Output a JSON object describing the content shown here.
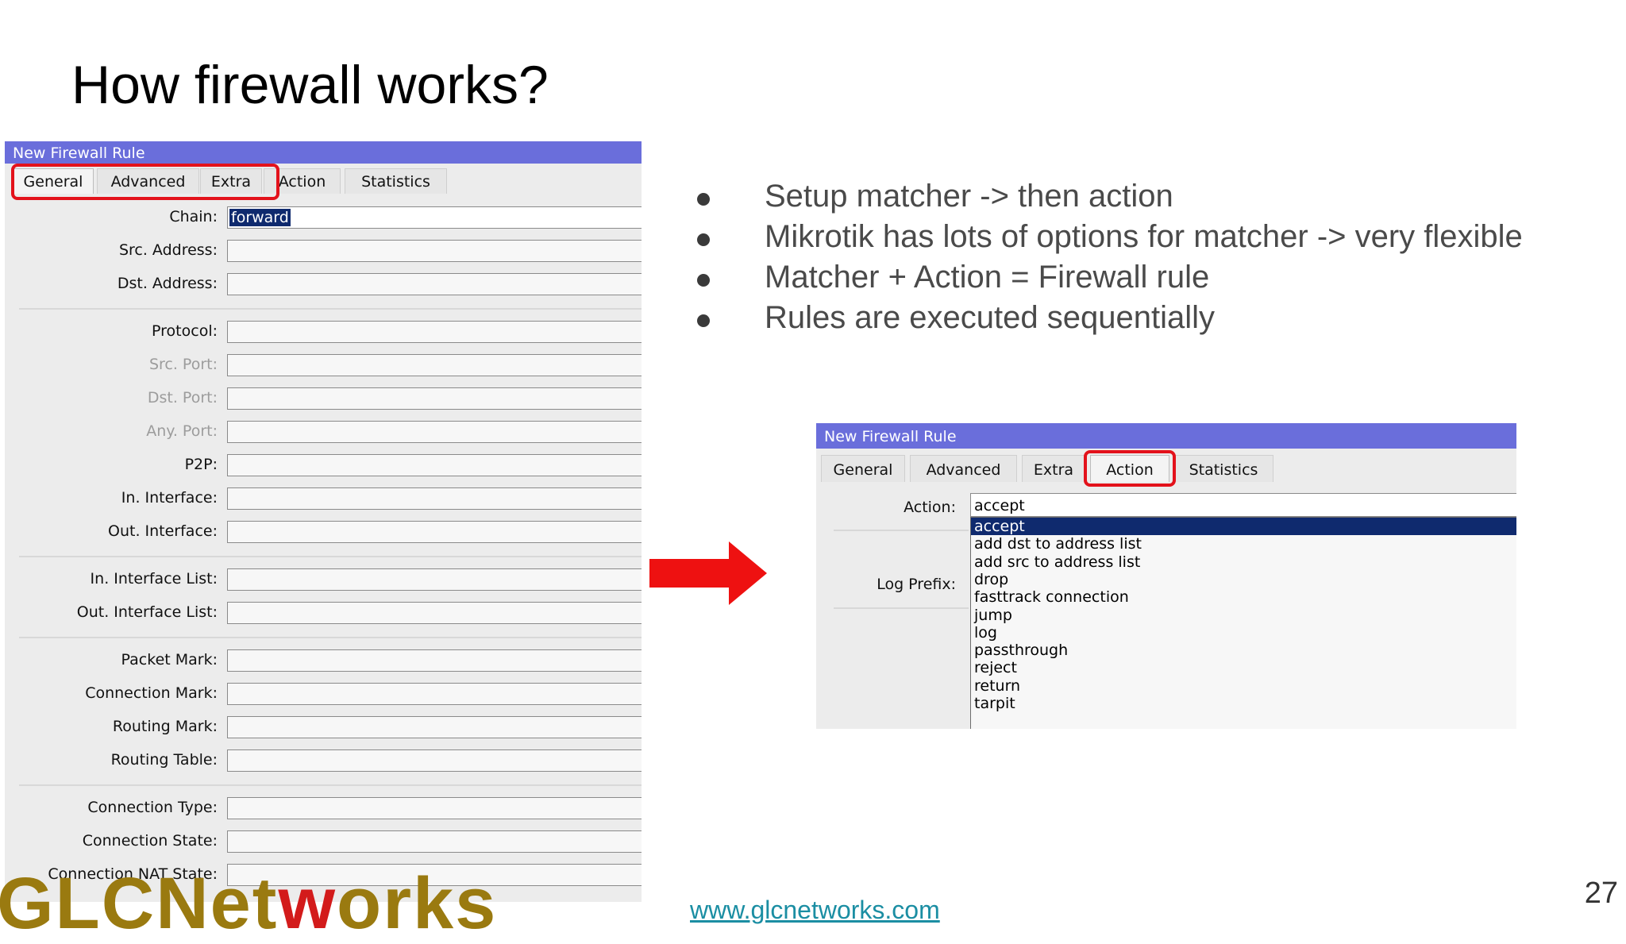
{
  "slide": {
    "title": "How firewall works?",
    "bullets": [
      "Setup matcher -> then action",
      "Mikrotik has lots of options for matcher -> very flexible",
      "Matcher + Action = Firewall rule",
      "Rules are executed sequentially"
    ],
    "footer_link": "www.glcnetworks.com",
    "page_number": "27",
    "logo_text_a": "GLC",
    "logo_text_b": "Net",
    "logo_text_c": "w",
    "logo_text_d": "orks"
  },
  "left_window": {
    "title": "New Firewall Rule",
    "tabs": [
      "General",
      "Advanced",
      "Extra",
      "Action",
      "Statistics"
    ],
    "active_tab": "General",
    "chain": {
      "label": "Chain:",
      "value": "forward"
    },
    "fields": [
      {
        "label": "Src. Address:"
      },
      {
        "label": "Dst. Address:"
      },
      {
        "label": "Protocol:"
      },
      {
        "label": "Src. Port:"
      },
      {
        "label": "Dst. Port:"
      },
      {
        "label": "Any. Port:"
      },
      {
        "label": "P2P:"
      },
      {
        "label": "In. Interface:"
      },
      {
        "label": "Out. Interface:"
      },
      {
        "label": "In. Interface List:"
      },
      {
        "label": "Out. Interface List:"
      },
      {
        "label": "Packet Mark:"
      },
      {
        "label": "Connection Mark:"
      },
      {
        "label": "Routing Mark:"
      },
      {
        "label": "Routing Table:"
      },
      {
        "label": "Connection Type:"
      },
      {
        "label": "Connection State:"
      },
      {
        "label": "Connection NAT State:"
      }
    ]
  },
  "right_window": {
    "title": "New Firewall Rule",
    "tabs": [
      "General",
      "Advanced",
      "Extra",
      "Action",
      "Statistics"
    ],
    "active_tab": "Action",
    "action_label": "Action:",
    "action_value": "accept",
    "log_prefix_label": "Log Prefix:",
    "action_options": [
      "accept",
      "add dst to address list",
      "add src to address list",
      "drop",
      "fasttrack connection",
      "jump",
      "log",
      "passthrough",
      "reject",
      "return",
      "tarpit"
    ],
    "selected_option": "accept"
  },
  "colors": {
    "title_bar": "#6a6edb",
    "highlight": "#e3121b",
    "selection": "#0f2a6e",
    "link": "#1b8ea3"
  }
}
